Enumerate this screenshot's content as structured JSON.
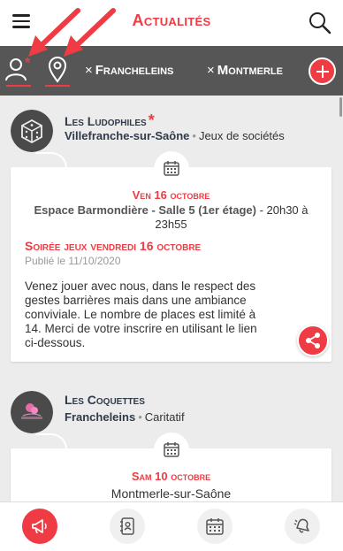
{
  "header": {
    "title": "Actualités"
  },
  "filters": {
    "chips": [
      {
        "remove": "×",
        "label": "Francheleins"
      },
      {
        "remove": "×",
        "label": "Montmerle"
      }
    ]
  },
  "feed": {
    "posts": [
      {
        "org": {
          "name": "Les Ludophiles",
          "star": "*",
          "city": "Villefranche-sur-Saône",
          "category": "Jeux de sociétés"
        },
        "date": "Ven 16 octobre",
        "place": "Espace Barmondière - Salle 5 (1er étage)",
        "time": " - 20h30 à 23h55",
        "title": "Soirée jeux vendredi 16 octobre",
        "published": "Publié le 11/10/2020",
        "description": "Venez jouer avec nous, dans le respect des gestes barrières mais dans une ambiance conviviale. Le nombre de places est limité à 14. Merci de votre inscrire en utilisant le lien ci-dessous."
      },
      {
        "org": {
          "name": "Les Coquettes",
          "city": "Francheleins",
          "category": "Caritatif"
        },
        "date": "Sam 10 octobre",
        "place": "Montmerle-sur-Saône"
      }
    ]
  },
  "nav": {
    "items": [
      "megaphone-icon",
      "contacts-icon",
      "calendar-icon",
      "notifications-icon"
    ]
  },
  "colors": {
    "accent": "#ef3b43",
    "filterbar": "#565656",
    "text_dark": "#2f3a4a"
  }
}
